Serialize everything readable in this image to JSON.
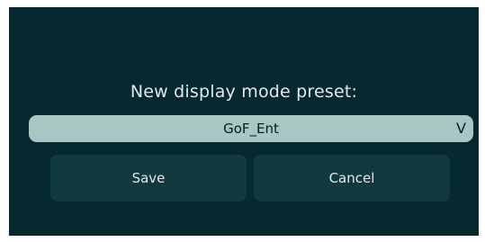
{
  "dialog": {
    "prompt": "New display mode preset:",
    "preset": {
      "selected": "GoF_Ent",
      "chevron_glyph": "V"
    },
    "buttons": {
      "save_label": "Save",
      "cancel_label": "Cancel"
    }
  },
  "colors": {
    "background": "#05292e",
    "select_fill": "#a8c7c3",
    "button_fill": "#113a3f",
    "text_light": "#e3e8e8"
  }
}
